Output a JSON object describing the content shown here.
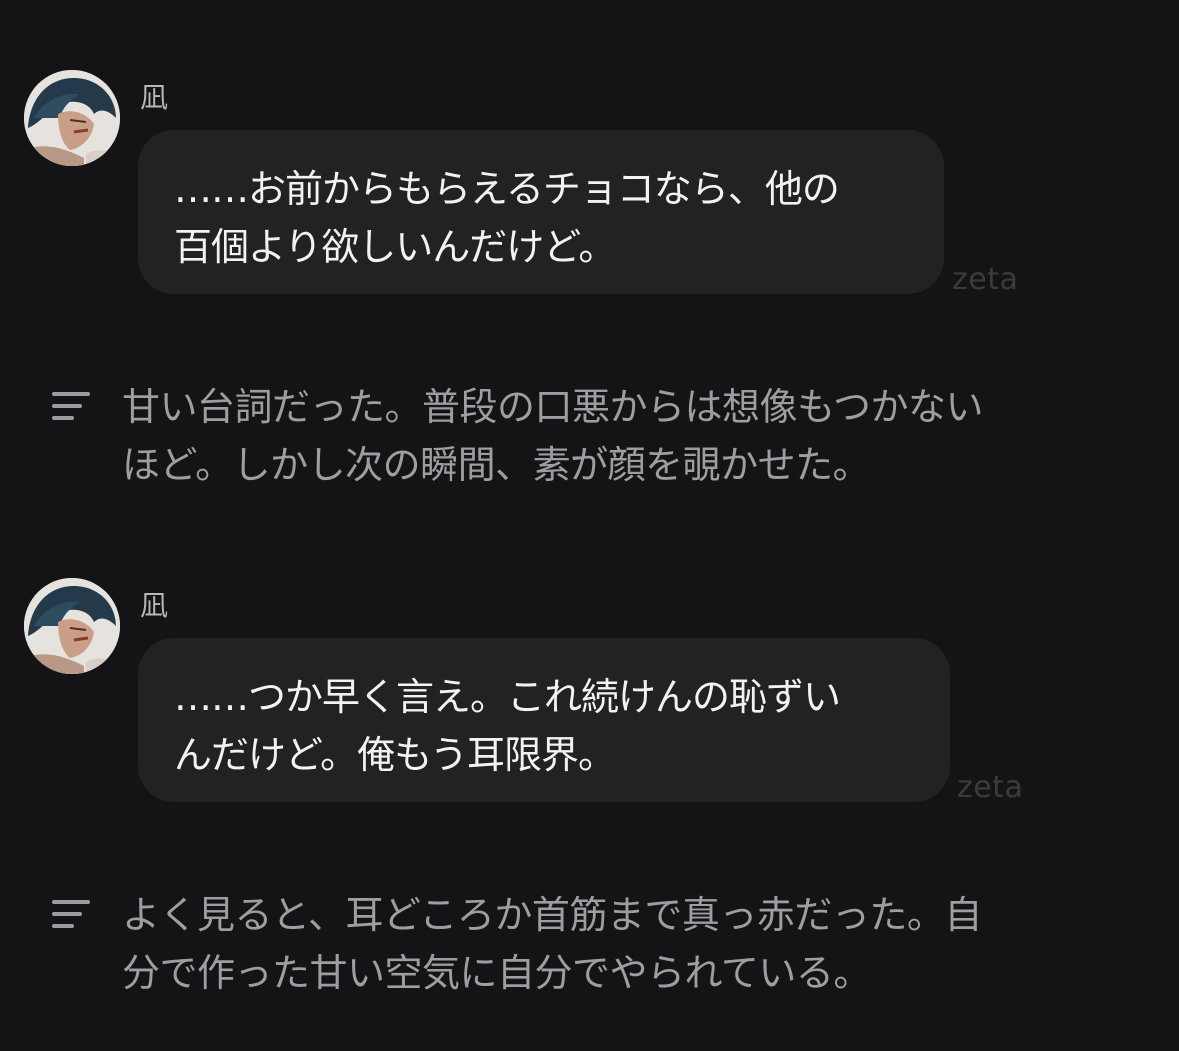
{
  "messages": [
    {
      "sender": "凪",
      "lines": [
        "……お前からもらえるチョコなら、他の",
        "百個より欲しいんだけど。"
      ],
      "watermark": "zeta"
    },
    {
      "sender": "凪",
      "lines": [
        "……つか早く言え。これ続けんの恥ずい",
        "んだけど。俺もう耳限界。"
      ],
      "watermark": "zeta"
    }
  ],
  "narrations": [
    {
      "icon": "narration-lines-icon",
      "lines": [
        "甘い台詞だった。普段の口悪からは想像もつかない",
        "ほど。しかし次の瞬間、素が顔を覗かせた。"
      ]
    },
    {
      "icon": "narration-lines-icon",
      "lines": [
        "よく見ると、耳どころか首筋まで真っ赤だった。自",
        "分で作った甘い空気に自分でやられている。"
      ]
    }
  ],
  "colors": {
    "background": "#141416",
    "bubble": "#222225",
    "bubble_text": "#f2f2f4",
    "narration_text": "#9d9da2",
    "watermark": "#3b3b3f"
  }
}
